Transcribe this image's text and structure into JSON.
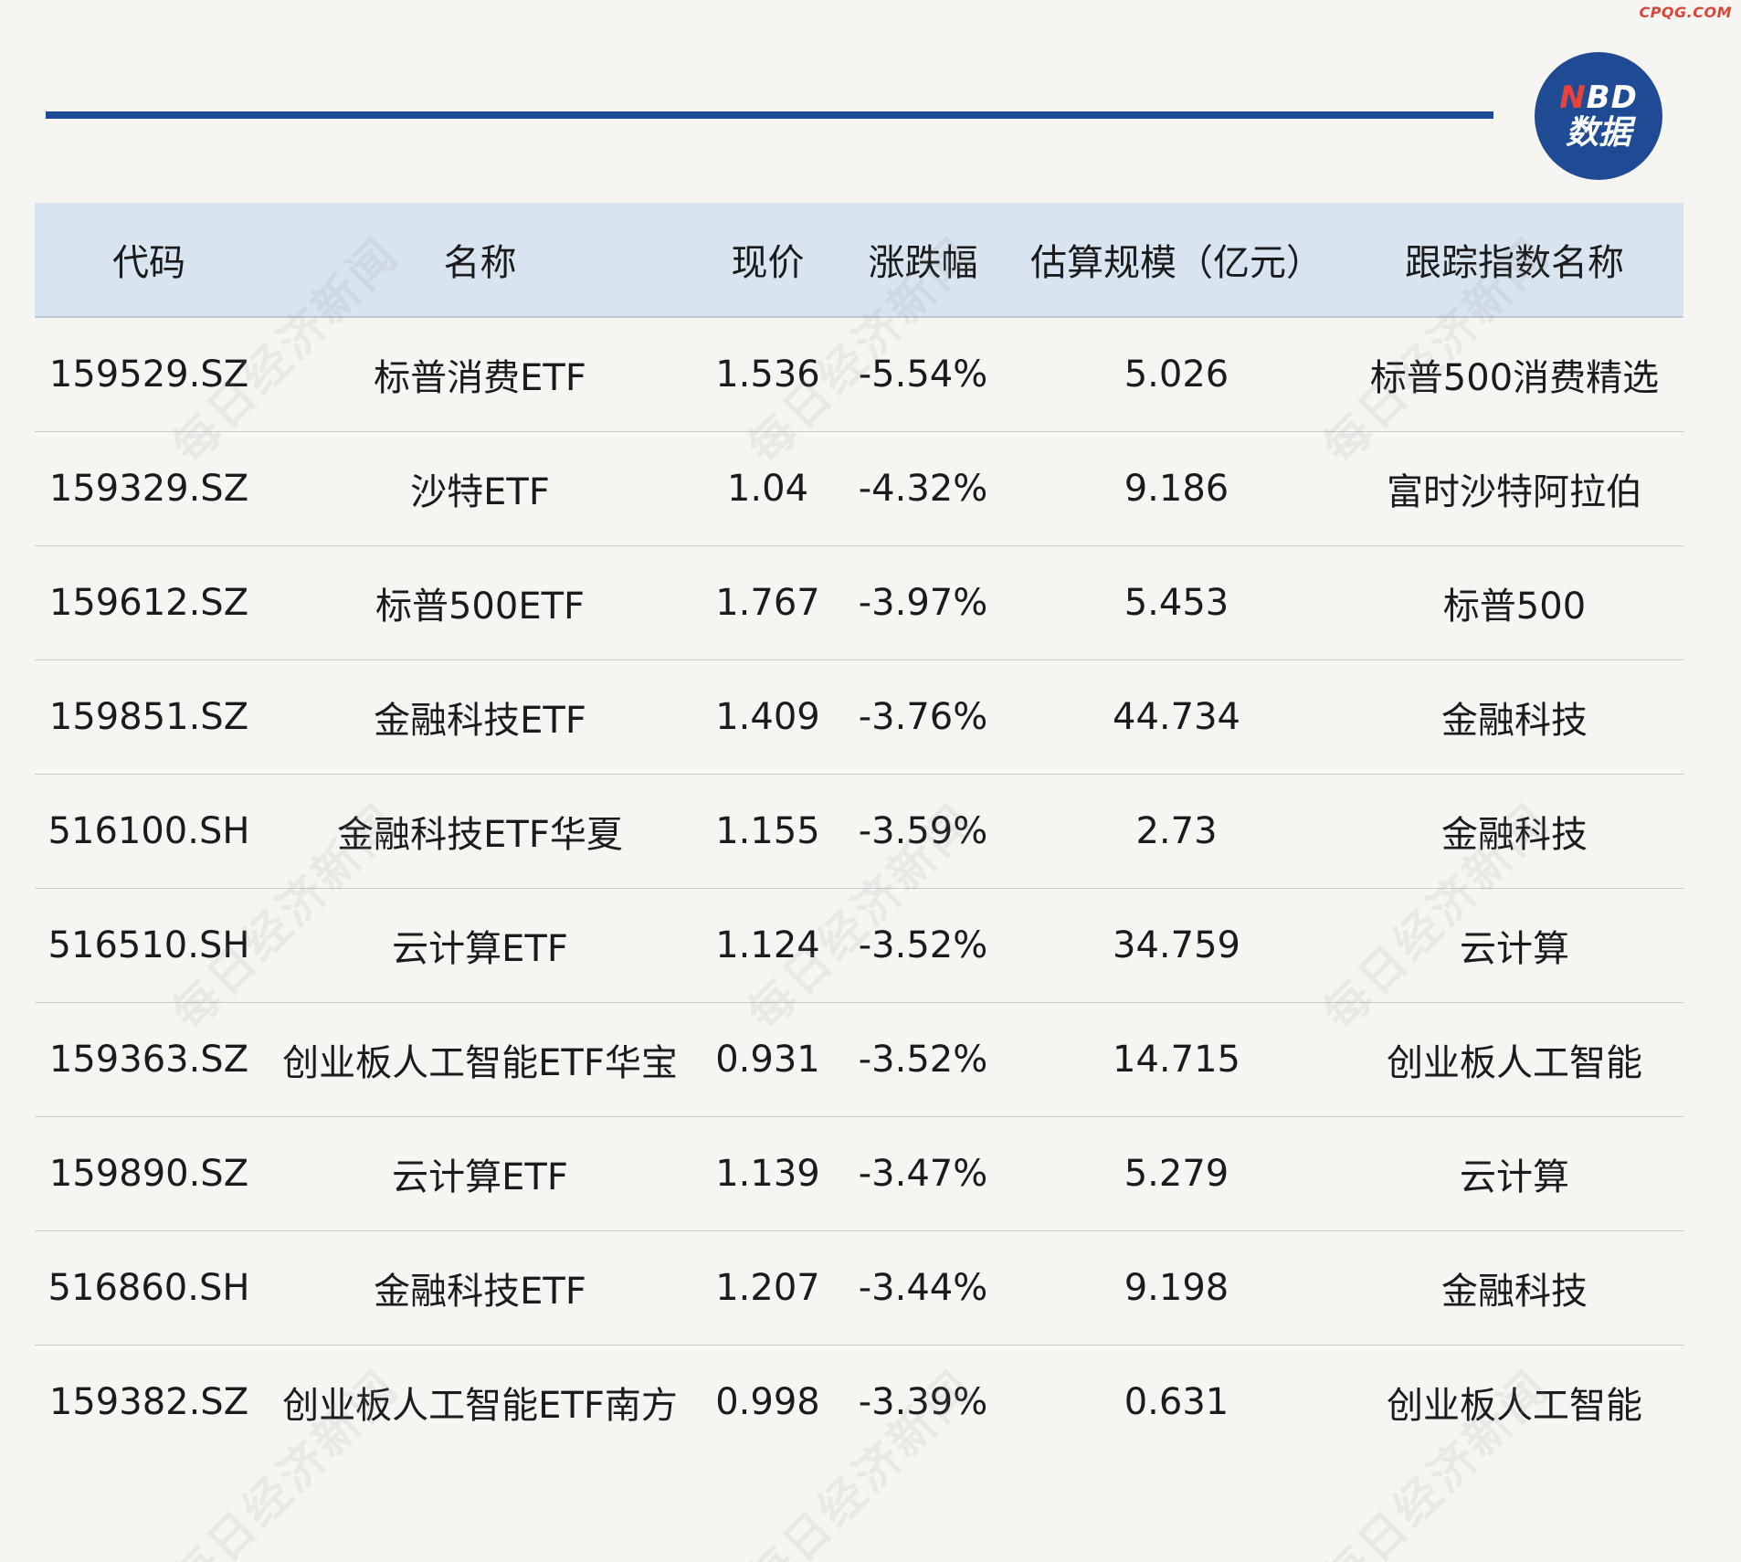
{
  "header": {
    "source_tag": "CPQG.COM",
    "logo_line1_first": "N",
    "logo_line1_rest": "BD",
    "logo_line2": "数据",
    "watermark_text": "每日经济新闻"
  },
  "table": {
    "columns": [
      "代码",
      "名称",
      "现价",
      "涨跌幅",
      "估算规模（亿元）",
      "跟踪指数名称"
    ],
    "rows": [
      [
        "159529.SZ",
        "标普消费ETF",
        "1.536",
        "-5.54%",
        "5.026",
        "标普500消费精选"
      ],
      [
        "159329.SZ",
        "沙特ETF",
        "1.04",
        "-4.32%",
        "9.186",
        "富时沙特阿拉伯"
      ],
      [
        "159612.SZ",
        "标普500ETF",
        "1.767",
        "-3.97%",
        "5.453",
        "标普500"
      ],
      [
        "159851.SZ",
        "金融科技ETF",
        "1.409",
        "-3.76%",
        "44.734",
        "金融科技"
      ],
      [
        "516100.SH",
        "金融科技ETF华夏",
        "1.155",
        "-3.59%",
        "2.73",
        "金融科技"
      ],
      [
        "516510.SH",
        "云计算ETF",
        "1.124",
        "-3.52%",
        "34.759",
        "云计算"
      ],
      [
        "159363.SZ",
        "创业板人工智能ETF华宝",
        "0.931",
        "-3.52%",
        "14.715",
        "创业板人工智能"
      ],
      [
        "159890.SZ",
        "云计算ETF",
        "1.139",
        "-3.47%",
        "5.279",
        "云计算"
      ],
      [
        "516860.SH",
        "金融科技ETF",
        "1.207",
        "-3.44%",
        "9.198",
        "金融科技"
      ],
      [
        "159382.SZ",
        "创业板人工智能ETF南方",
        "0.998",
        "-3.39%",
        "0.631",
        "创业板人工智能"
      ]
    ]
  },
  "colors": {
    "rule": "#1b4a96",
    "header_bg": "#d8e4ef",
    "logo_bg": "#1e4b94",
    "logo_accent": "#e8433b",
    "page_bg": "#f7f5f2"
  }
}
